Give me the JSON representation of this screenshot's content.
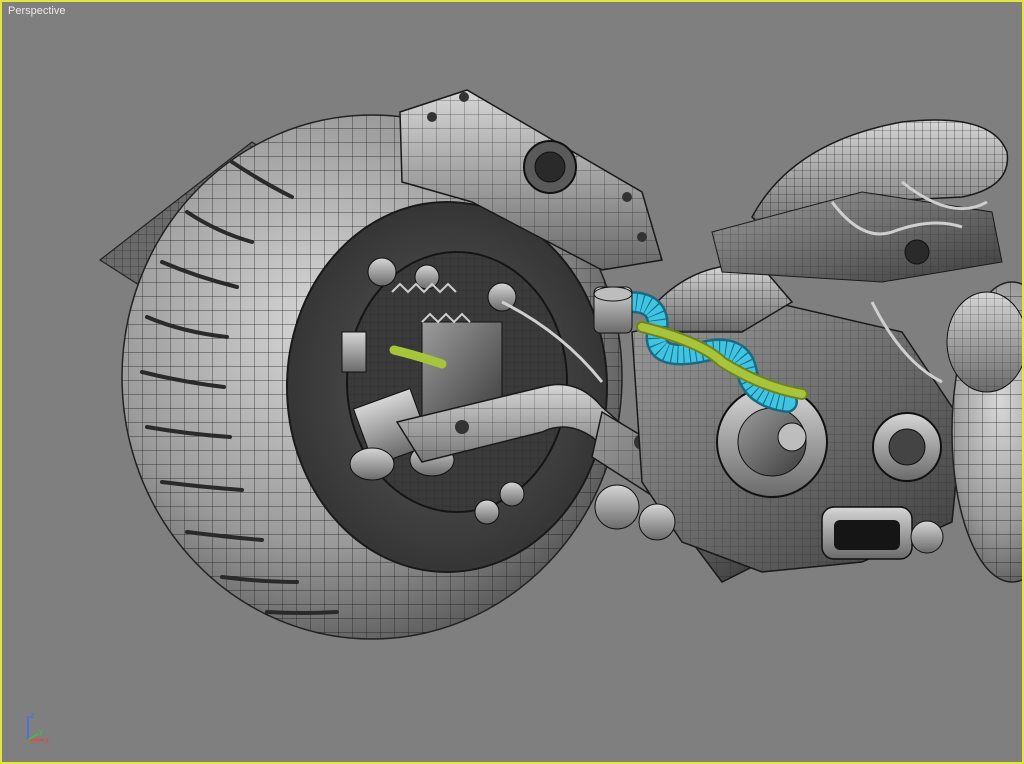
{
  "viewport": {
    "label": "Perspective",
    "active_border_color": "#e4e43a",
    "background_color": "#7f7f7f"
  },
  "scene": {
    "subject": "motorcycle-wireframe-model",
    "highlight_colors": {
      "hose_blue": "#3fc4e4",
      "hose_green": "#a8c43a"
    }
  },
  "axis_gizmo": {
    "z_label": "z",
    "x_label": "x",
    "y_label": "y",
    "colors": {
      "z": "#3a6cff",
      "x": "#ff3a3a",
      "y": "#3ac43a"
    }
  }
}
